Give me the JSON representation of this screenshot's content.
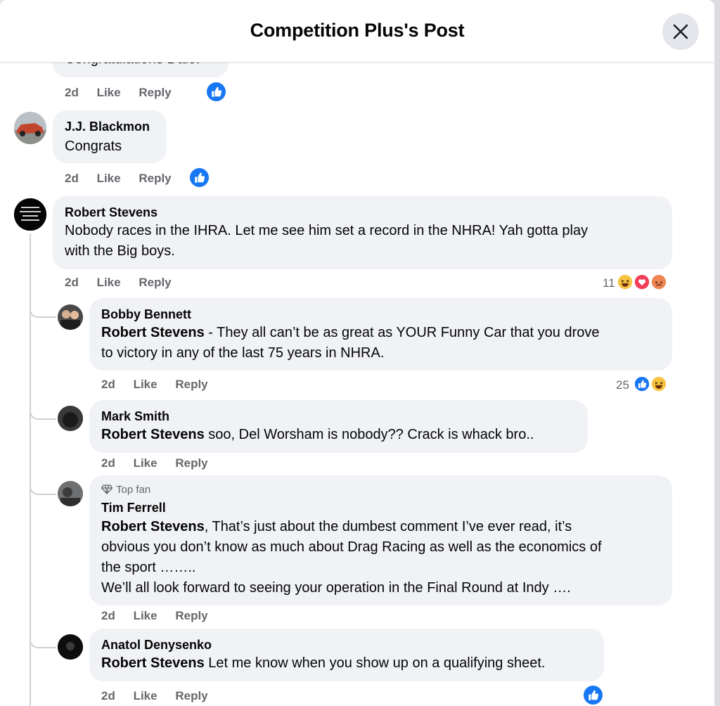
{
  "dialog": {
    "title": "Competition Plus's Post"
  },
  "meta": {
    "time": "2d",
    "like": "Like",
    "reply": "Reply"
  },
  "colors": {
    "accent": "#1877f2",
    "bubble": "#f0f2f5",
    "meta_text": "#65676b"
  },
  "comments": [
    {
      "text": "Congratulations Dale!",
      "reaction_icons": [
        "like-icon"
      ]
    },
    {
      "author": "J.J. Blackmon",
      "text": "Congrats",
      "reaction_icons": [
        "like-icon"
      ]
    },
    {
      "author": "Robert Stevens",
      "lines": [
        "Nobody races in the IHRA. Let me see him set a record in the NHRA! Yah gotta play",
        "with the Big boys."
      ],
      "reaction_count": "11",
      "reaction_icons": [
        "haha-icon",
        "love-icon",
        "angry-icon"
      ]
    }
  ],
  "replies": [
    {
      "author": "Bobby Bennett",
      "mention": "Robert Stevens",
      "line1_rest": " - They all can’t be as great as YOUR Funny Car that you drove",
      "line2": "to victory in any of the last 75 years in NHRA.",
      "reaction_count": "25",
      "reaction_icons": [
        "like-icon",
        "haha-icon"
      ]
    },
    {
      "author": "Mark Smith",
      "mention": "Robert Stevens",
      "line1_rest": " soo, Del Worsham is nobody?? Crack is whack bro.."
    },
    {
      "badge": "Top fan",
      "author": "Tim Ferrell",
      "mention": "Robert Stevens",
      "line1_rest": ", That’s just about the dumbest comment I’ve ever read, it’s",
      "line2": "obvious you don’t know as much about Drag Racing as well as the economics of",
      "line3": "the sport ……..",
      "line4": "We’ll all look forward to seeing your operation in the Final Round at Indy …."
    },
    {
      "author": "Anatol Denysenko",
      "mention": "Robert Stevens",
      "line1_rest": " Let me know when you show up on a qualifying sheet.",
      "reaction_icons": [
        "like-icon"
      ]
    }
  ]
}
